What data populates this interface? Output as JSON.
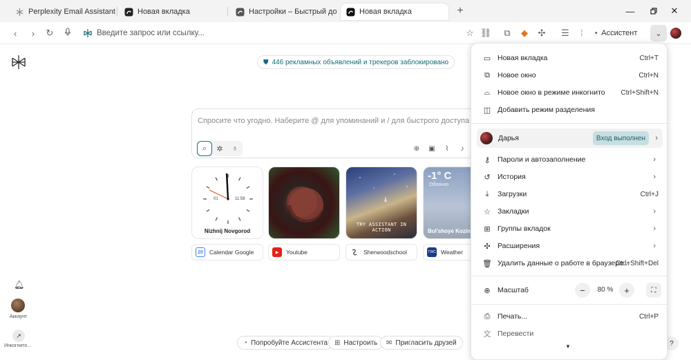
{
  "tabs": [
    {
      "title": "Perplexity Email Assistant",
      "active": false
    },
    {
      "title": "Новая вкладка",
      "active": false
    },
    {
      "title": "Настройки – Быстрый доступ",
      "active": false
    },
    {
      "title": "Новая вкладка",
      "active": true
    }
  ],
  "toolbar": {
    "omnibox_placeholder": "Введите запрос или ссылку...",
    "assistant_label": "Ассистент"
  },
  "page": {
    "blocked_text": "446 рекламных объявлений и трекеров заблокировано",
    "search_placeholder": "Спросите что угодно. Наберите @ для упоминаний и / для быстрого доступа.",
    "cards": {
      "clock_city": "Nizhnij Novgorod",
      "clock_digital": "11:58",
      "clock_small": "01",
      "space_caption": "TRY ASSISTANT IN ACTION",
      "weather_temp": "-1° C",
      "weather_desc": "Облачно",
      "weather_city": "Bol'shoye Kozino"
    },
    "shortcuts": [
      {
        "label": "Calendar Google",
        "icon_text": "20",
        "color": "#4285f4"
      },
      {
        "label": "Youtube",
        "icon_text": "▶",
        "color": "#e62117"
      },
      {
        "label": "Sherwoodschool",
        "icon_text": "",
        "color": "#ffffff"
      },
      {
        "label": "Weather",
        "icon_text": "",
        "color": "#1a3a8a"
      }
    ],
    "bottom_buttons": [
      {
        "label": "Попробуйте Ассистента"
      },
      {
        "label": "Настроить"
      },
      {
        "label": "Пригласить друзей"
      }
    ],
    "sidebar": {
      "account_label": "Аккаунт",
      "incognito_label": "Инкогнито..."
    },
    "help_label": "?"
  },
  "menu": {
    "items_top": [
      {
        "label": "Новая вкладка",
        "shortcut": "Ctrl+T",
        "icon": "new-tab-icon"
      },
      {
        "label": "Новое окно",
        "shortcut": "Ctrl+N",
        "icon": "new-window-icon"
      },
      {
        "label": "Новое окно в режиме инкогнито",
        "shortcut": "Ctrl+Shift+N",
        "icon": "incognito-icon"
      },
      {
        "label": "Добавить режим разделения",
        "shortcut": "",
        "icon": "split-view-icon"
      }
    ],
    "profile": {
      "name": "Дарья",
      "status": "Вход выполнен"
    },
    "items_mid": [
      {
        "label": "Пароли и автозаполнение",
        "shortcut": "",
        "icon": "key-icon"
      },
      {
        "label": "История",
        "shortcut": "",
        "icon": "history-icon"
      },
      {
        "label": "Загрузки",
        "shortcut": "Ctrl+J",
        "icon": "download-icon"
      },
      {
        "label": "Закладки",
        "shortcut": "",
        "icon": "star-icon"
      },
      {
        "label": "Группы вкладок",
        "shortcut": "",
        "icon": "tab-groups-icon"
      },
      {
        "label": "Расширения",
        "shortcut": "",
        "icon": "puzzle-icon"
      },
      {
        "label": "Удалить данные о работе в браузере...",
        "shortcut": "Ctrl+Shift+Del",
        "icon": "trash-icon"
      }
    ],
    "zoom": {
      "label": "Масштаб",
      "value": "80 %",
      "minus": "−",
      "plus": "+"
    },
    "items_bottom": [
      {
        "label": "Печать...",
        "shortcut": "Ctrl+P",
        "icon": "print-icon"
      },
      {
        "label": "Перевести",
        "shortcut": "",
        "icon": "translate-icon"
      }
    ]
  }
}
